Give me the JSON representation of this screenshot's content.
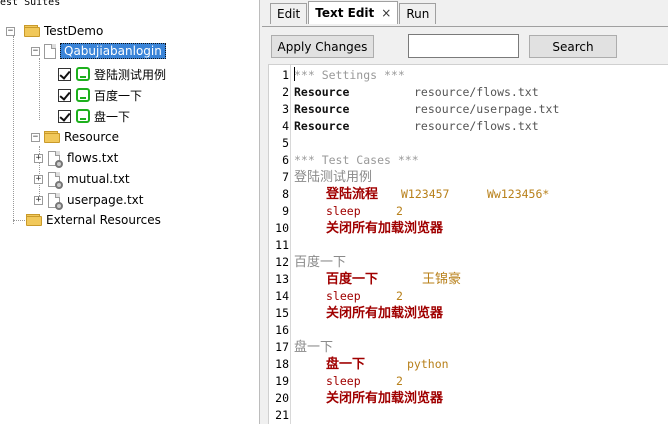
{
  "left": {
    "title": "Test Suites",
    "tree": {
      "root": "TestDemo",
      "suite": "Qabujiabanlogin",
      "cases": [
        "登陆测试用例",
        "百度一下",
        "盘一下"
      ],
      "resource_folder": "Resource",
      "resources": [
        "flows.txt",
        "mutual.txt",
        "userpage.txt"
      ],
      "external": "External Resources"
    }
  },
  "tabs": [
    {
      "label": "Edit"
    },
    {
      "label": "Text Edit",
      "close": "×"
    },
    {
      "label": "Run"
    }
  ],
  "toolbar": {
    "apply_label": "Apply Changes",
    "search_value": "",
    "search_label": "Search"
  },
  "editor": {
    "line_numbers": [
      "1",
      "2",
      "3",
      "4",
      "5",
      "6",
      "7",
      "8",
      "9",
      "10",
      "11",
      "12",
      "13",
      "14",
      "15",
      "16",
      "17",
      "18",
      "19",
      "20",
      "21"
    ],
    "l1": "*** Settings ***",
    "l2": {
      "kw": "Resource",
      "val": "resource/flows.txt"
    },
    "l3": {
      "kw": "Resource",
      "val": "resource/userpage.txt"
    },
    "l4": {
      "kw": "Resource",
      "val": "resource/flows.txt"
    },
    "l6": "*** Test Cases ***",
    "l7": "登陆测试用例",
    "l8": {
      "kw": "登陆流程",
      "a1": "W123457",
      "a2": "Ww123456*"
    },
    "l9": {
      "kw": "sleep",
      "a1": "2"
    },
    "l10": "关闭所有加载浏览器",
    "l12": "百度一下",
    "l13": {
      "kw": "百度一下",
      "a1": "王锦豪"
    },
    "l14": {
      "kw": "sleep",
      "a1": "2"
    },
    "l15": "关闭所有加载浏览器",
    "l17": "盘一下",
    "l18": {
      "kw": "盘一下",
      "a1": "python"
    },
    "l19": {
      "kw": "sleep",
      "a1": "2"
    },
    "l20": "关闭所有加载浏览器"
  },
  "colors": {
    "selection": "#3a84d8",
    "keyword_red": "#a00000",
    "argument": "#b8801a",
    "comment": "#999999",
    "testcase_icon": "#1db01d"
  },
  "icons": [
    "folder-icon",
    "document-icon",
    "checkbox-icon",
    "testcase-icon",
    "resource-file-icon",
    "close-icon",
    "tree-toggle-icon"
  ]
}
